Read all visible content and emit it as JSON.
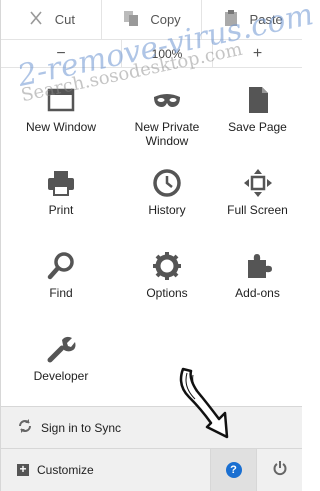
{
  "edit": {
    "cut_label": "Cut",
    "copy_label": "Copy",
    "paste_label": "Paste"
  },
  "zoom": {
    "minus": "−",
    "value": "100%",
    "plus": "+"
  },
  "grid": {
    "new_window": "New Window",
    "new_private_window": "New Private\nWindow",
    "save_page": "Save Page",
    "print": "Print",
    "history": "History",
    "full_screen": "Full Screen",
    "find": "Find",
    "options": "Options",
    "add_ons": "Add-ons",
    "developer": "Developer"
  },
  "footer": {
    "sign_in": "Sign in to Sync",
    "customize": "Customize",
    "help_glyph": "?",
    "accent": "#1a6fd1"
  },
  "watermark": {
    "line1": "2-remove-virus.com",
    "line2": "Search.sosodesktop.com"
  },
  "icons": [
    "cut-icon",
    "copy-icon",
    "paste-icon",
    "new-window-icon",
    "private-mask-icon",
    "save-page-icon",
    "print-icon",
    "history-clock-icon",
    "fullscreen-icon",
    "find-magnifier-icon",
    "options-gear-icon",
    "addons-puzzle-icon",
    "developer-wrench-icon",
    "sync-icon",
    "customize-plus-icon",
    "help-icon",
    "quit-power-icon"
  ]
}
